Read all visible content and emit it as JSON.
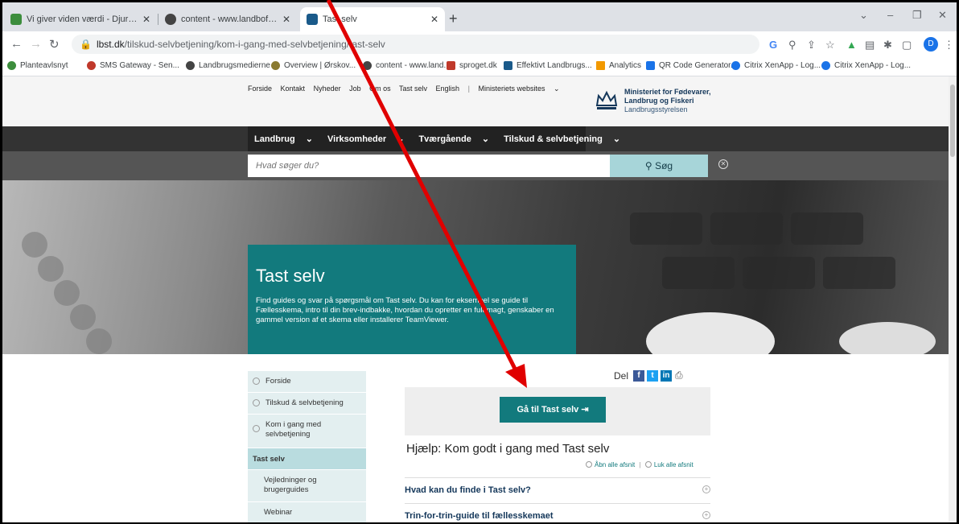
{
  "browser": {
    "tabs": [
      {
        "title": "Vi giver viden værdi - Djursland L",
        "favicon_color": "#3c8d3c"
      },
      {
        "title": "content - www.landboforening.dk",
        "favicon_color": "#444"
      },
      {
        "title": "Tast selv",
        "favicon_color": "#1a5a8a",
        "active": true
      }
    ],
    "url_host": "lbst.dk",
    "url_path": "/tilskud-selvbetjening/kom-i-gang-med-selvbetjening/tast-selv",
    "profile_initial": "D",
    "bookmarks": [
      {
        "label": "Planteavlsnyt",
        "color": "#3c8d3c"
      },
      {
        "label": "SMS Gateway - Sen...",
        "color": "#c0392b"
      },
      {
        "label": "Landbrugsmedierne",
        "color": "#444"
      },
      {
        "label": "Overview | Ørskov...",
        "color": "#8a7a30"
      },
      {
        "label": "content - www.land...",
        "color": "#444"
      },
      {
        "label": "sproget.dk",
        "color": "#c0392b"
      },
      {
        "label": "Effektivt Landbrugs...",
        "color": "#1a5a8a"
      },
      {
        "label": "Analytics",
        "color": "#f29900"
      },
      {
        "label": "QR Code Generator...",
        "color": "#1a73e8"
      },
      {
        "label": "Citrix XenApp - Log...",
        "color": "#1a73e8"
      },
      {
        "label": "Citrix XenApp - Log...",
        "color": "#1a73e8"
      }
    ]
  },
  "site": {
    "top_links": [
      "Forside",
      "Kontakt",
      "Nyheder",
      "Job",
      "Om os",
      "Tast selv",
      "English"
    ],
    "ministry_websites": "Ministeriets websites",
    "ministry_name_1": "Ministeriet for Fødevarer,",
    "ministry_name_2": "Landbrug og Fiskeri",
    "ministry_agency": "Landbrugsstyrelsen",
    "main_nav": [
      "Landbrug",
      "Virksomheder",
      "Tværgående",
      "Tilskud & selvbetjening"
    ],
    "search_placeholder": "Hvad søger du?",
    "search_button": "Søg"
  },
  "hero": {
    "title": "Tast selv",
    "text": "Find guides og svar på spørgsmål om Tast selv. Du kan for eksempel se guide til Fællesskema, intro til din brev-indbakke, hvordan du opretter en fuldmagt, genskaber en gammel version af et skema eller installerer TeamViewer."
  },
  "sidenav": [
    {
      "label": "Forside",
      "kind": "parent"
    },
    {
      "label": "Tilskud & selvbetjening",
      "kind": "parent"
    },
    {
      "label": "Kom i gang med selvbetjening",
      "kind": "parent"
    },
    {
      "label": "Tast selv",
      "kind": "active"
    },
    {
      "label": "Vejledninger og brugerguides",
      "kind": "sub"
    },
    {
      "label": "Webinar",
      "kind": "sub"
    }
  ],
  "content": {
    "share_label": "Del",
    "cta_label": "Gå til Tast selv",
    "help_heading": "Hjælp: Kom godt i gang med Tast selv",
    "open_all": "Åbn alle afsnit",
    "close_all": "Luk alle afsnit",
    "accordion": [
      "Hvad kan du finde i Tast selv?",
      "Trin-for-trin-guide til fællesskemaet"
    ]
  },
  "colors": {
    "teal": "#127a7d",
    "annotation_arrow": "#e00000"
  }
}
